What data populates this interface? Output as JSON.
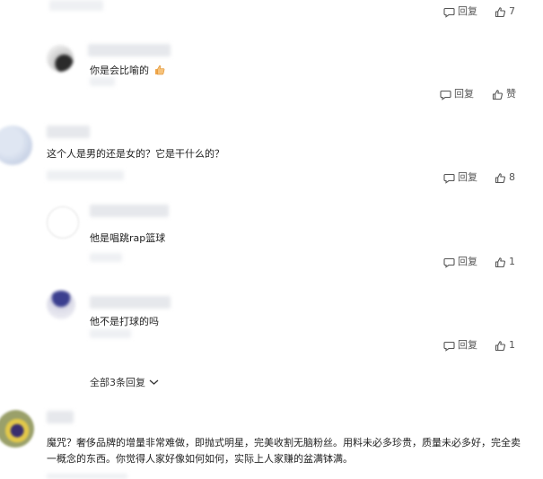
{
  "comments": [
    {
      "text": "",
      "reply": "回复",
      "likes": "7"
    },
    {
      "text": "你是会比喻的",
      "reply": "回复",
      "likes": "赞"
    },
    {
      "text": "这个人是男的还是女的？它是干什么的？",
      "reply": "回复",
      "likes": "8"
    },
    {
      "text": "他是唱跳rap篮球",
      "reply": "回复",
      "likes": "1"
    },
    {
      "text": "他不是打球的吗",
      "reply": "回复",
      "likes": "1"
    },
    {
      "text": "魔咒？奢侈品牌的增量非常难做，即抛式明星，完美收割无脑粉丝。用料未必多珍贵，质量未必多好，完全卖一概念的东西。你觉得人家好像如何如何，实际上人家赚的盆满钵满。"
    }
  ],
  "replies_toggle": "全部3条回复",
  "icons": {
    "reply": "comment-bubble-icon",
    "like": "thumbs-up-icon",
    "emoji": "thumbs-up-emoji-icon",
    "expand": "chevron-down-icon"
  },
  "colors": {
    "text": "#222222",
    "muted": "#555555",
    "redacted": "#e6e8ec"
  }
}
